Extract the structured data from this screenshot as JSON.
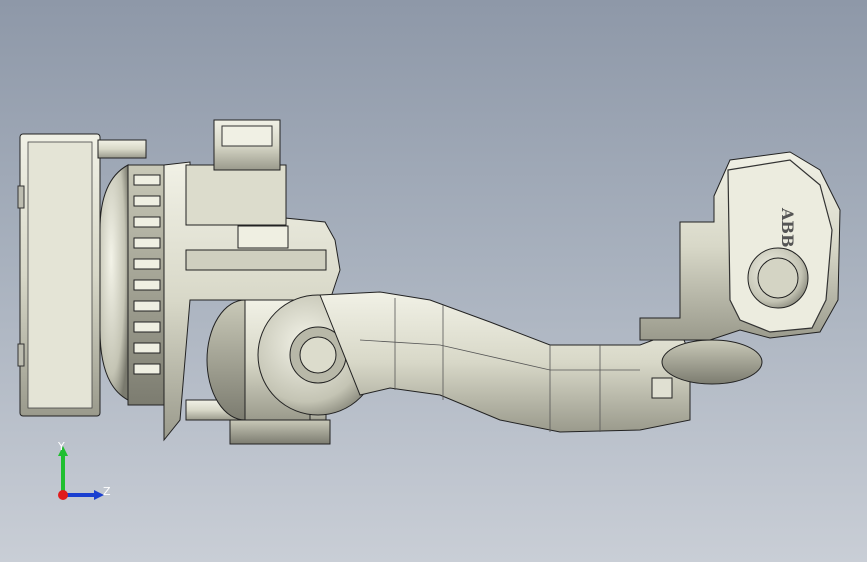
{
  "model": {
    "brand_text": "ABB"
  },
  "triad": {
    "y_label": "Y",
    "z_label": "Z",
    "colors": {
      "y": "#1fbf2f",
      "z": "#1a3fd0",
      "x": "#e11b1b"
    }
  },
  "background": {
    "top": "#8e98a8",
    "bottom": "#c9ced6"
  }
}
